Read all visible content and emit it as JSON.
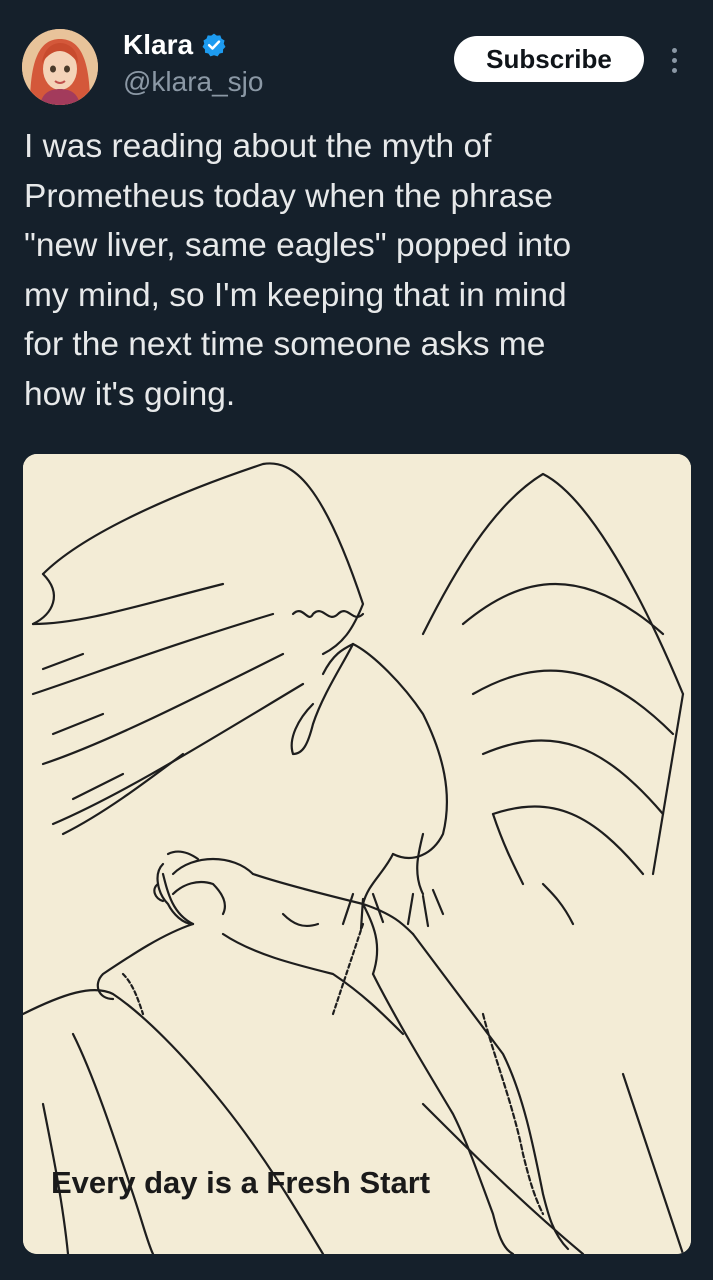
{
  "author": {
    "display_name": "Klara",
    "handle": "@klara_sjo",
    "verified": true
  },
  "actions": {
    "subscribe_label": "Subscribe"
  },
  "tweet": {
    "text": "I was reading about the myth of\nPrometheus today when the phrase\n\"new liver, same eagles\" popped into\nmy mind, so I'm keeping that in mind\nfor the next time someone asks me\nhow it's going."
  },
  "media": {
    "caption": "Every day is a Fresh Start"
  },
  "colors": {
    "background": "#15202b",
    "handle_gray": "#8b98a5",
    "verified_blue": "#1d9bf0",
    "subscribe_bg": "#ffffff",
    "image_paper": "#f3ecd6"
  }
}
